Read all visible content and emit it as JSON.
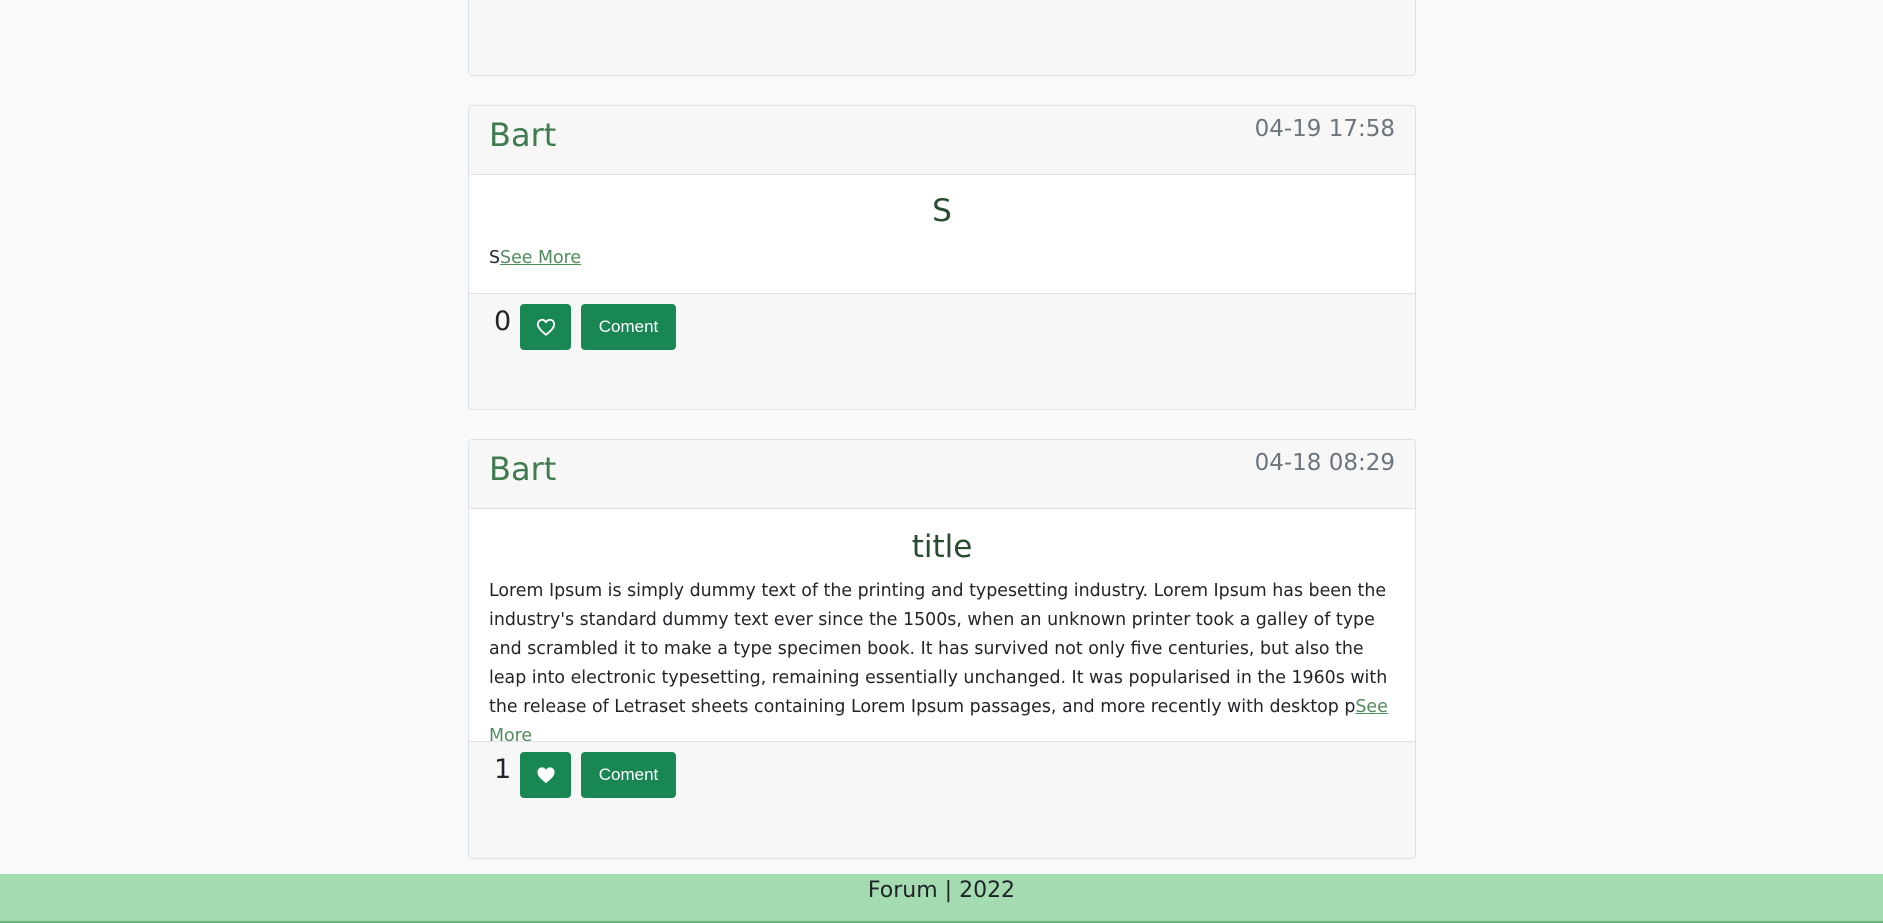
{
  "posts": [
    {
      "author": "",
      "date": "",
      "title": "",
      "content": "",
      "see_more": "",
      "likes": "",
      "comment_label": "Coment",
      "liked": false
    },
    {
      "author": "Bart",
      "date": "04-19 17:58",
      "title": "S",
      "content": "S",
      "see_more": "See More",
      "likes": "0",
      "comment_label": "Coment",
      "liked": false
    },
    {
      "author": "Bart",
      "date": "04-18 08:29",
      "title": "title",
      "content": "Lorem Ipsum is simply dummy text of the printing and typesetting industry. Lorem Ipsum has been the industry's standard dummy text ever since the 1500s, when an unknown printer took a galley of type and scrambled it to make a type specimen book. It has survived not only five centuries, but also the leap into electronic typesetting, remaining essentially unchanged. It was popularised in the 1960s with the release of Letraset sheets containing Lorem Ipsum passages, and more recently with desktop p",
      "see_more": "See More",
      "likes": "1",
      "comment_label": "Coment",
      "liked": true
    }
  ],
  "icons": {
    "like_outline": "heart-outline-icon",
    "like_filled": "heart-filled-icon"
  },
  "colors": {
    "accent": "#198754",
    "author": "#3f7b4e",
    "footer_bg": "#a4dbb0"
  },
  "footer": {
    "text": "Forum | 2022"
  }
}
